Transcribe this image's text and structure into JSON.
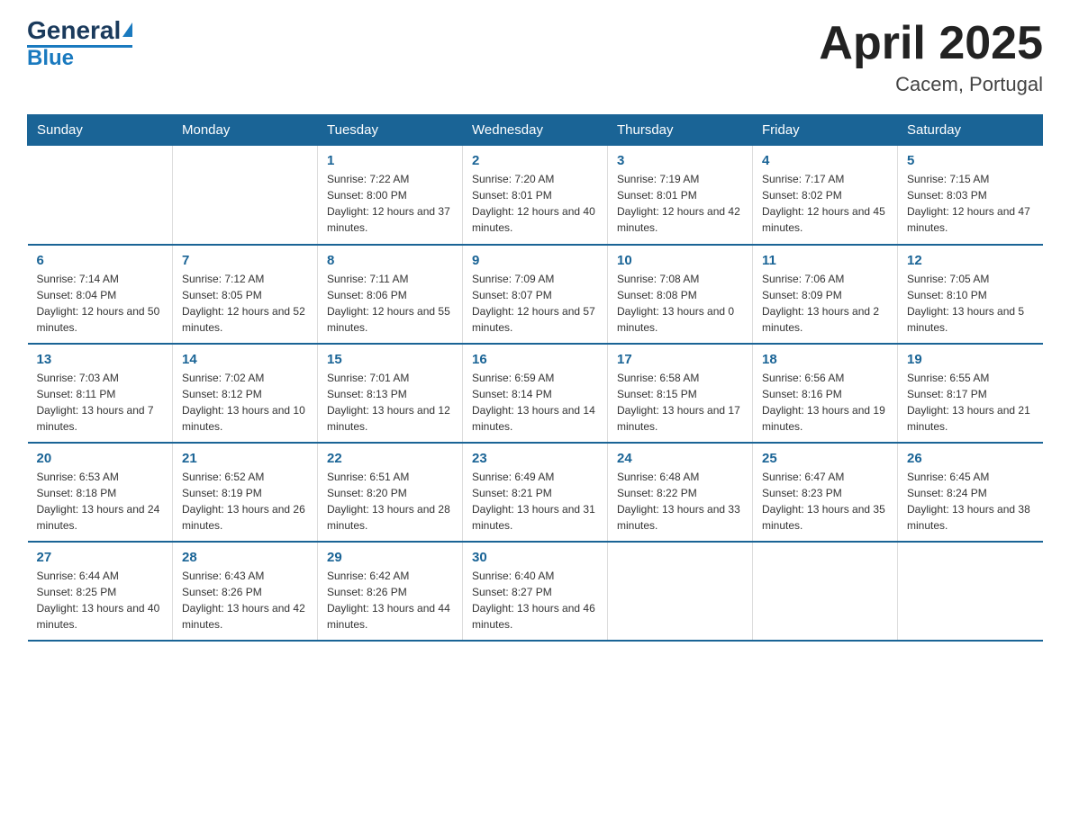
{
  "header": {
    "logo_text_dark": "General",
    "logo_text_blue": "Blue",
    "title": "April 2025",
    "subtitle": "Cacem, Portugal"
  },
  "days_of_week": [
    "Sunday",
    "Monday",
    "Tuesday",
    "Wednesday",
    "Thursday",
    "Friday",
    "Saturday"
  ],
  "weeks": [
    [
      null,
      null,
      {
        "num": "1",
        "sunrise": "7:22 AM",
        "sunset": "8:00 PM",
        "daylight": "12 hours and 37 minutes."
      },
      {
        "num": "2",
        "sunrise": "7:20 AM",
        "sunset": "8:01 PM",
        "daylight": "12 hours and 40 minutes."
      },
      {
        "num": "3",
        "sunrise": "7:19 AM",
        "sunset": "8:01 PM",
        "daylight": "12 hours and 42 minutes."
      },
      {
        "num": "4",
        "sunrise": "7:17 AM",
        "sunset": "8:02 PM",
        "daylight": "12 hours and 45 minutes."
      },
      {
        "num": "5",
        "sunrise": "7:15 AM",
        "sunset": "8:03 PM",
        "daylight": "12 hours and 47 minutes."
      }
    ],
    [
      {
        "num": "6",
        "sunrise": "7:14 AM",
        "sunset": "8:04 PM",
        "daylight": "12 hours and 50 minutes."
      },
      {
        "num": "7",
        "sunrise": "7:12 AM",
        "sunset": "8:05 PM",
        "daylight": "12 hours and 52 minutes."
      },
      {
        "num": "8",
        "sunrise": "7:11 AM",
        "sunset": "8:06 PM",
        "daylight": "12 hours and 55 minutes."
      },
      {
        "num": "9",
        "sunrise": "7:09 AM",
        "sunset": "8:07 PM",
        "daylight": "12 hours and 57 minutes."
      },
      {
        "num": "10",
        "sunrise": "7:08 AM",
        "sunset": "8:08 PM",
        "daylight": "13 hours and 0 minutes."
      },
      {
        "num": "11",
        "sunrise": "7:06 AM",
        "sunset": "8:09 PM",
        "daylight": "13 hours and 2 minutes."
      },
      {
        "num": "12",
        "sunrise": "7:05 AM",
        "sunset": "8:10 PM",
        "daylight": "13 hours and 5 minutes."
      }
    ],
    [
      {
        "num": "13",
        "sunrise": "7:03 AM",
        "sunset": "8:11 PM",
        "daylight": "13 hours and 7 minutes."
      },
      {
        "num": "14",
        "sunrise": "7:02 AM",
        "sunset": "8:12 PM",
        "daylight": "13 hours and 10 minutes."
      },
      {
        "num": "15",
        "sunrise": "7:01 AM",
        "sunset": "8:13 PM",
        "daylight": "13 hours and 12 minutes."
      },
      {
        "num": "16",
        "sunrise": "6:59 AM",
        "sunset": "8:14 PM",
        "daylight": "13 hours and 14 minutes."
      },
      {
        "num": "17",
        "sunrise": "6:58 AM",
        "sunset": "8:15 PM",
        "daylight": "13 hours and 17 minutes."
      },
      {
        "num": "18",
        "sunrise": "6:56 AM",
        "sunset": "8:16 PM",
        "daylight": "13 hours and 19 minutes."
      },
      {
        "num": "19",
        "sunrise": "6:55 AM",
        "sunset": "8:17 PM",
        "daylight": "13 hours and 21 minutes."
      }
    ],
    [
      {
        "num": "20",
        "sunrise": "6:53 AM",
        "sunset": "8:18 PM",
        "daylight": "13 hours and 24 minutes."
      },
      {
        "num": "21",
        "sunrise": "6:52 AM",
        "sunset": "8:19 PM",
        "daylight": "13 hours and 26 minutes."
      },
      {
        "num": "22",
        "sunrise": "6:51 AM",
        "sunset": "8:20 PM",
        "daylight": "13 hours and 28 minutes."
      },
      {
        "num": "23",
        "sunrise": "6:49 AM",
        "sunset": "8:21 PM",
        "daylight": "13 hours and 31 minutes."
      },
      {
        "num": "24",
        "sunrise": "6:48 AM",
        "sunset": "8:22 PM",
        "daylight": "13 hours and 33 minutes."
      },
      {
        "num": "25",
        "sunrise": "6:47 AM",
        "sunset": "8:23 PM",
        "daylight": "13 hours and 35 minutes."
      },
      {
        "num": "26",
        "sunrise": "6:45 AM",
        "sunset": "8:24 PM",
        "daylight": "13 hours and 38 minutes."
      }
    ],
    [
      {
        "num": "27",
        "sunrise": "6:44 AM",
        "sunset": "8:25 PM",
        "daylight": "13 hours and 40 minutes."
      },
      {
        "num": "28",
        "sunrise": "6:43 AM",
        "sunset": "8:26 PM",
        "daylight": "13 hours and 42 minutes."
      },
      {
        "num": "29",
        "sunrise": "6:42 AM",
        "sunset": "8:26 PM",
        "daylight": "13 hours and 44 minutes."
      },
      {
        "num": "30",
        "sunrise": "6:40 AM",
        "sunset": "8:27 PM",
        "daylight": "13 hours and 46 minutes."
      },
      null,
      null,
      null
    ]
  ]
}
